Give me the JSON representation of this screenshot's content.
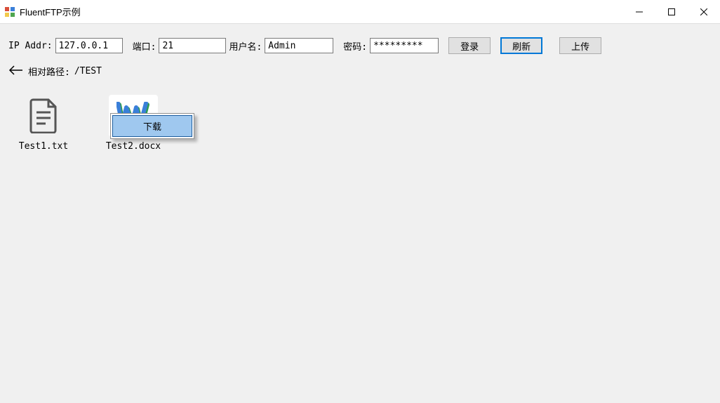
{
  "window": {
    "title": "FluentFTP示例"
  },
  "toolbar": {
    "ip_label": "IP Addr:",
    "ip_value": "127.0.0.1",
    "port_label": "端口:",
    "port_value": "21",
    "user_label": "用户名:",
    "user_value": "Admin",
    "pass_label": "密码:",
    "pass_value": "*********",
    "login_btn": "登录",
    "refresh_btn": "刷新",
    "upload_btn": "上传"
  },
  "path": {
    "label": "相对路径:",
    "value": "/TEST"
  },
  "files": [
    {
      "name": "Test1.txt",
      "icon": "text-file"
    },
    {
      "name": "Test2.docx",
      "icon": "word-file"
    }
  ],
  "context_menu": {
    "download": "下载"
  }
}
